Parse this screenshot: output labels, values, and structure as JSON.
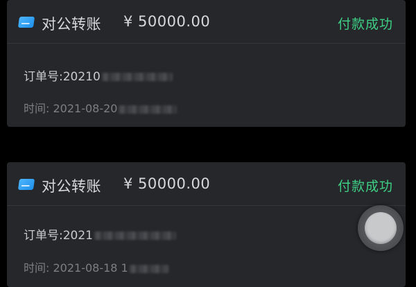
{
  "transactions": [
    {
      "icon": "transfer-card-icon",
      "type": "对公转账",
      "amount": "¥ 50000.00",
      "status": "付款成功",
      "order_label": "订单号:",
      "order_visible": "20210",
      "time_label": "时间: ",
      "time_visible": "2021-08-20"
    },
    {
      "icon": "transfer-card-icon",
      "type": "对公转账",
      "amount": "¥ 50000.00",
      "status": "付款成功",
      "order_label": "订单号:",
      "order_visible": "2021",
      "time_label": "时间: ",
      "time_visible": "2021-08-18 1"
    }
  ],
  "colors": {
    "background": "#000000",
    "card": "#25272b",
    "text": "#d7d8da",
    "status_success": "#3ecf85",
    "muted": "#7d7f84",
    "icon_blue": "#2a9cf0"
  }
}
